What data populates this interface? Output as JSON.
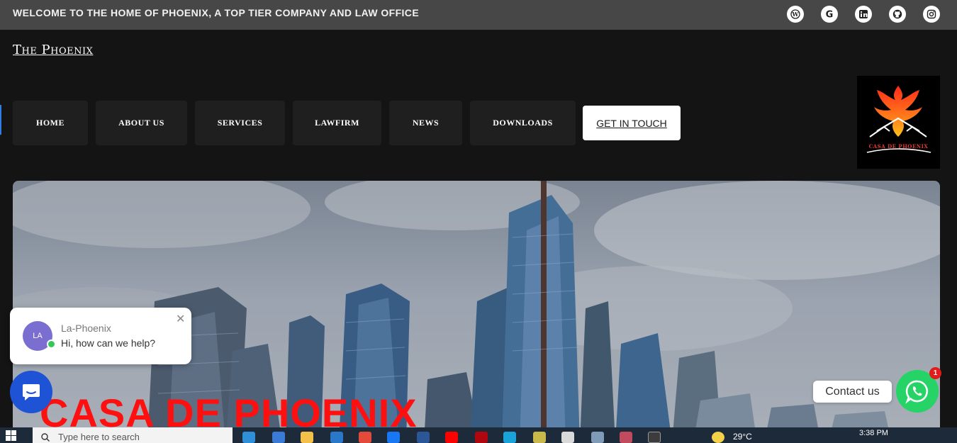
{
  "topbar": {
    "welcome_text": "WELCOME TO THE HOME OF PHOENIX, A TOP TIER COMPANY AND LAW OFFICE",
    "social_icons": [
      "wordpress-icon",
      "google-icon",
      "linkedin-icon",
      "github-icon",
      "instagram-icon"
    ]
  },
  "site": {
    "title": "The Phoenix"
  },
  "nav": {
    "items": [
      {
        "label": "HOME"
      },
      {
        "label": "ABOUT US"
      },
      {
        "label": "SERVICES"
      },
      {
        "label": "LAWFIRM"
      },
      {
        "label": "NEWS"
      },
      {
        "label": "DOWNLOADS"
      }
    ],
    "cta_label": "GET IN TOUCH"
  },
  "logo": {
    "text": "CASA DE PHOENIX"
  },
  "hero": {
    "title": "CASA DE PHOENIX"
  },
  "chat": {
    "avatar_initials": "LA",
    "name": "La-Phoenix",
    "message": "Hi, how can we help?"
  },
  "whatsapp": {
    "label": "Contact us",
    "badge_count": "1"
  },
  "taskbar": {
    "search_placeholder": "Type here to search",
    "weather": "29°C",
    "time": "3:38 PM"
  },
  "colors": {
    "hero_title": "#ff1010",
    "whatsapp": "#25d366",
    "chat_launcher": "#1f53d6"
  }
}
